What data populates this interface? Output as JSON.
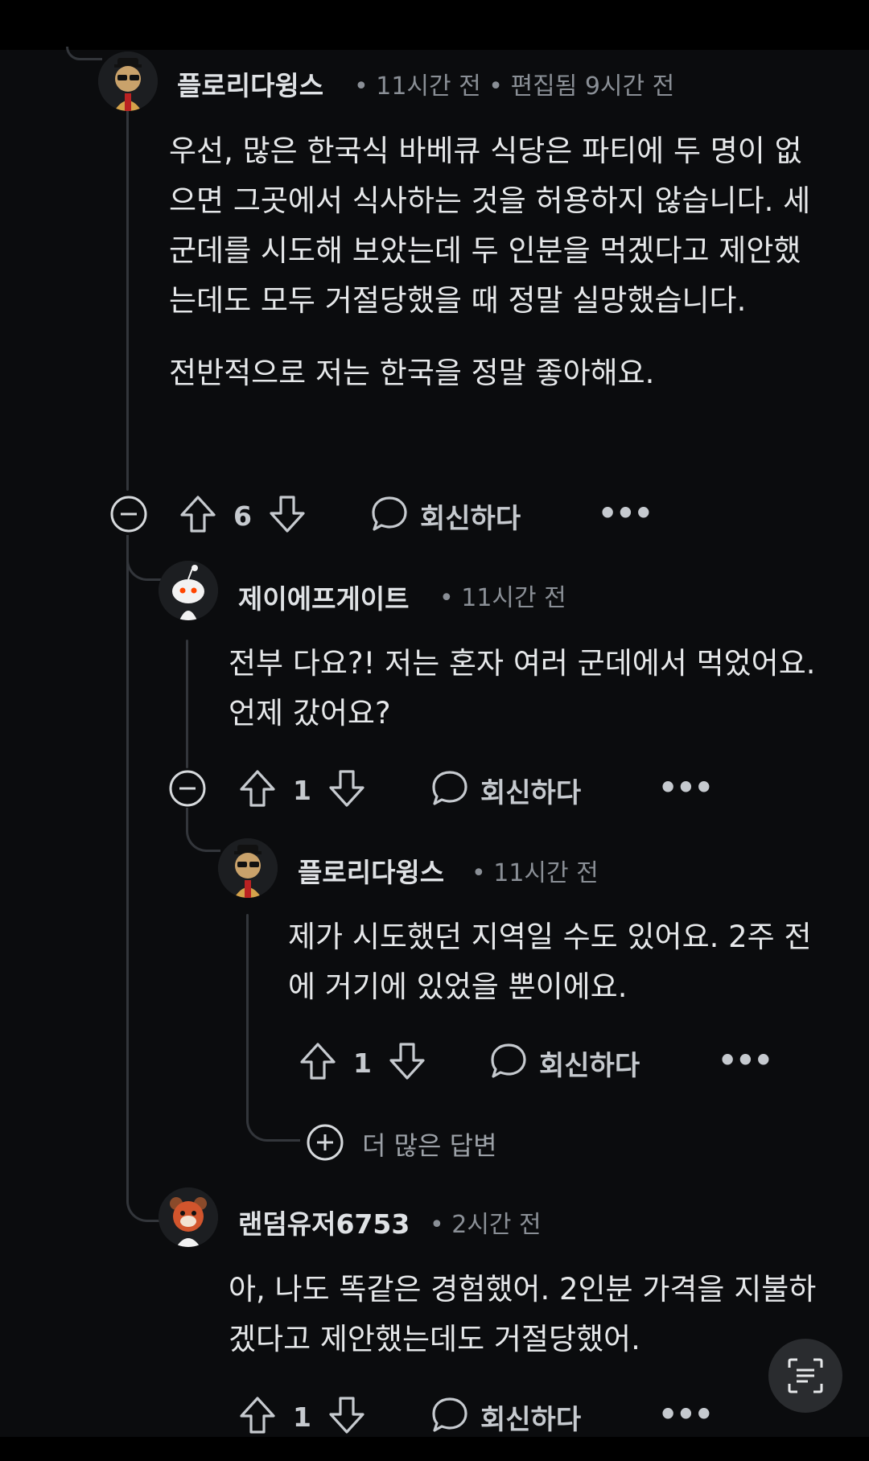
{
  "comments": [
    {
      "username": "플로리다윙스",
      "meta": "• 11시간 전 • 편집됨 9시간 전",
      "body": [
        "우선, 많은 한국식 바베큐 식당은 파티에 두 명이 없으면 그곳에서 식사하는 것을 허용하지 않습니다. 세 군데를 시도해 보았는데 두 인분을 먹겠다고 제안했는데도 모두 거절당했을 때 정말 실망했습니다.",
        "전반적으로 저는 한국을 정말 좋아해요."
      ],
      "votes": "6",
      "reply_label": "회신하다",
      "more_label": "•••"
    },
    {
      "username": "제이에프게이트",
      "meta": "• 11시간 전",
      "body": [
        "전부 다요?! 저는 혼자 여러 군데에서 먹었어요. 언제 갔어요?"
      ],
      "votes": "1",
      "reply_label": "회신하다",
      "more_label": "•••"
    },
    {
      "username": "플로리다윙스",
      "meta": "• 11시간 전",
      "body": [
        "제가 시도했던 지역일 수도 있어요. 2주 전에 거기에 있었을 뿐이에요."
      ],
      "votes": "1",
      "reply_label": "회신하다",
      "more_label": "•••"
    },
    {
      "username": "랜덤유저6753",
      "meta": "• 2시간 전",
      "body": [
        "아, 나도 똑같은 경험했어. 2인분 가격을 지불하겠다고 제안했는데도 거절당했어."
      ],
      "votes": "1",
      "reply_label": "회신하다",
      "more_label": "•••"
    }
  ],
  "more_replies_label": "더 많은 답변",
  "icons": {
    "upvote": "arrow-up-icon",
    "downvote": "arrow-down-icon",
    "reply": "speech-bubble-icon",
    "collapse": "minus-circle-icon",
    "expand": "plus-circle-icon",
    "scan": "text-scan-icon"
  },
  "colors": {
    "background": "#0b0c0e",
    "text": "#e6e8ea",
    "muted": "#8a8f96",
    "thread": "#33363b"
  }
}
